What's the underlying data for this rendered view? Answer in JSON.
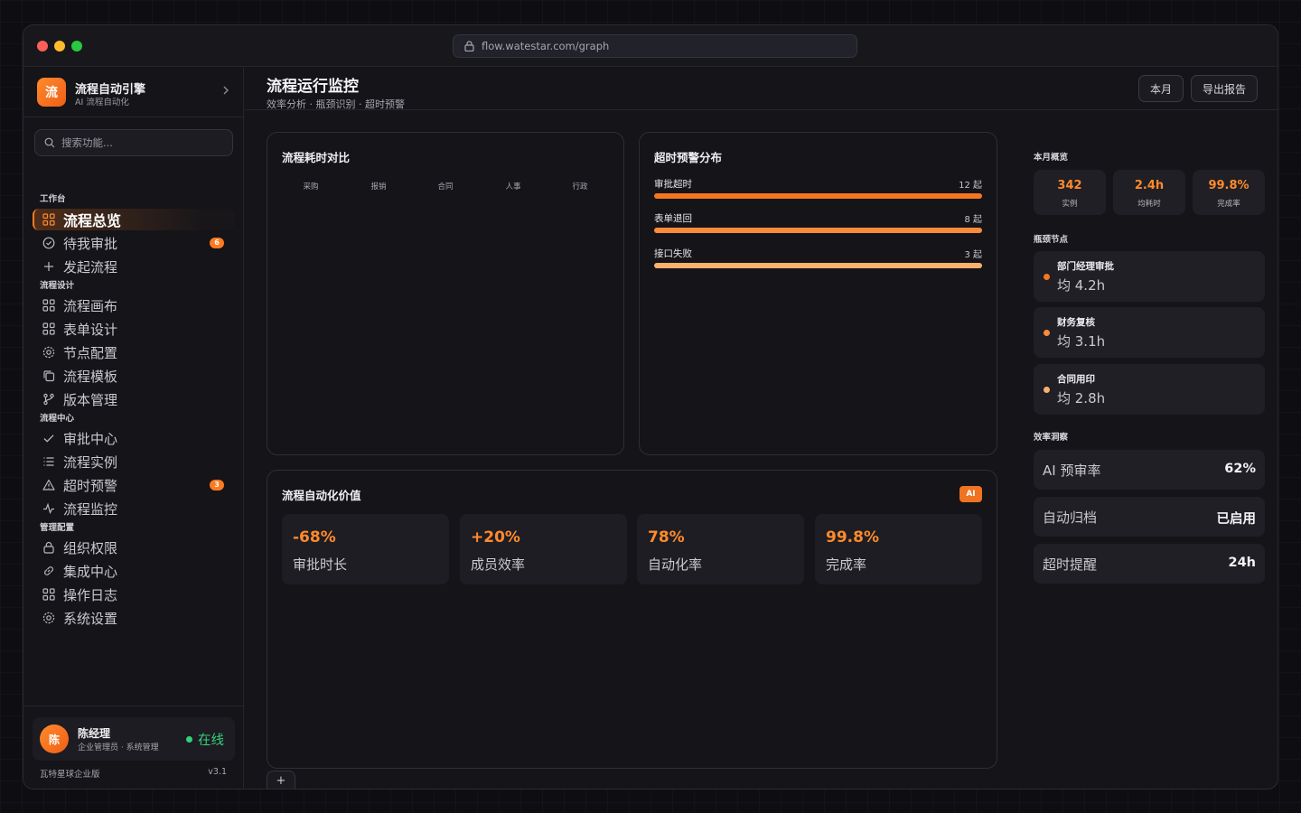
{
  "browser": {
    "url": "flow.watestar.com/graph"
  },
  "brand": {
    "logo_char": "流",
    "title": "流程自动引擎",
    "subtitle": "AI 流程自动化"
  },
  "search": {
    "placeholder": "搜索功能..."
  },
  "nav": {
    "sections": [
      {
        "label": "工作台",
        "items": [
          {
            "label": "流程总览",
            "icon": "grid-icon",
            "active": true
          },
          {
            "label": "待我审批",
            "icon": "check-circle-icon",
            "badge": "6"
          },
          {
            "label": "发起流程",
            "icon": "plus-icon"
          }
        ]
      },
      {
        "label": "流程设计",
        "items": [
          {
            "label": "流程画布",
            "icon": "grid-icon"
          },
          {
            "label": "表单设计",
            "icon": "grid-icon"
          },
          {
            "label": "节点配置",
            "icon": "gear-icon"
          },
          {
            "label": "流程模板",
            "icon": "copy-icon"
          },
          {
            "label": "版本管理",
            "icon": "branch-icon"
          }
        ]
      },
      {
        "label": "流程中心",
        "items": [
          {
            "label": "审批中心",
            "icon": "check-icon"
          },
          {
            "label": "流程实例",
            "icon": "list-icon"
          },
          {
            "label": "超时预警",
            "icon": "warning-icon",
            "badge": "3"
          },
          {
            "label": "流程监控",
            "icon": "activity-icon"
          }
        ]
      },
      {
        "label": "管理配置",
        "items": [
          {
            "label": "组织权限",
            "icon": "lock-icon"
          },
          {
            "label": "集成中心",
            "icon": "link-icon"
          },
          {
            "label": "操作日志",
            "icon": "grid-icon"
          },
          {
            "label": "系统设置",
            "icon": "gear-icon"
          }
        ]
      }
    ]
  },
  "user": {
    "avatar_char": "陈",
    "name": "陈经理",
    "role": "企业管理员 · 系统管理",
    "status": "在线"
  },
  "footer": {
    "edition": "瓦特星球企业版",
    "version": "v3.1"
  },
  "header": {
    "title": "流程运行监控",
    "subtitle": "效率分析 · 瓶颈识别 · 超时预警",
    "btn_month": "本月",
    "btn_export": "导出报告"
  },
  "duration_card": {
    "title": "流程耗时对比",
    "categories": [
      "采购",
      "报销",
      "合同",
      "人事",
      "行政"
    ]
  },
  "alert_card": {
    "title": "超时预警分布",
    "rows": [
      {
        "label": "审批超时",
        "count": "12 起",
        "value": 12,
        "color": "#f5761f"
      },
      {
        "label": "表单退回",
        "count": "8 起",
        "value": 8,
        "color": "#fb8b3a"
      },
      {
        "label": "接口失败",
        "count": "3 起",
        "value": 3,
        "color": "#fbb06d"
      }
    ]
  },
  "value_card": {
    "title": "流程自动化价值",
    "tag": "AI",
    "metrics": [
      {
        "value": "-68%",
        "label": "审批时长"
      },
      {
        "value": "+20%",
        "label": "成员效率"
      },
      {
        "value": "78%",
        "label": "自动化率"
      },
      {
        "value": "99.8%",
        "label": "完成率"
      }
    ]
  },
  "tabbar": {
    "add_label": "+"
  },
  "rail": {
    "overview_label": "本月概览",
    "stats": [
      {
        "value": "342",
        "label": "实例"
      },
      {
        "value": "2.4h",
        "label": "均耗时"
      },
      {
        "value": "99.8%",
        "label": "完成率"
      }
    ],
    "bottleneck_label": "瓶颈节点",
    "bottlenecks": [
      {
        "name": "部门经理审批",
        "value": "均 4.2h",
        "color": "#f5761f"
      },
      {
        "name": "财务复核",
        "value": "均 3.1h",
        "color": "#fb8b3a"
      },
      {
        "name": "合同用印",
        "value": "均 2.8h",
        "color": "#fbb06d"
      }
    ],
    "insight_label": "效率洞察",
    "insights": [
      {
        "label": "AI 预审率",
        "value": "62%"
      },
      {
        "label": "自动归档",
        "value": "已启用"
      },
      {
        "label": "超时提醒",
        "value": "24h"
      }
    ]
  }
}
